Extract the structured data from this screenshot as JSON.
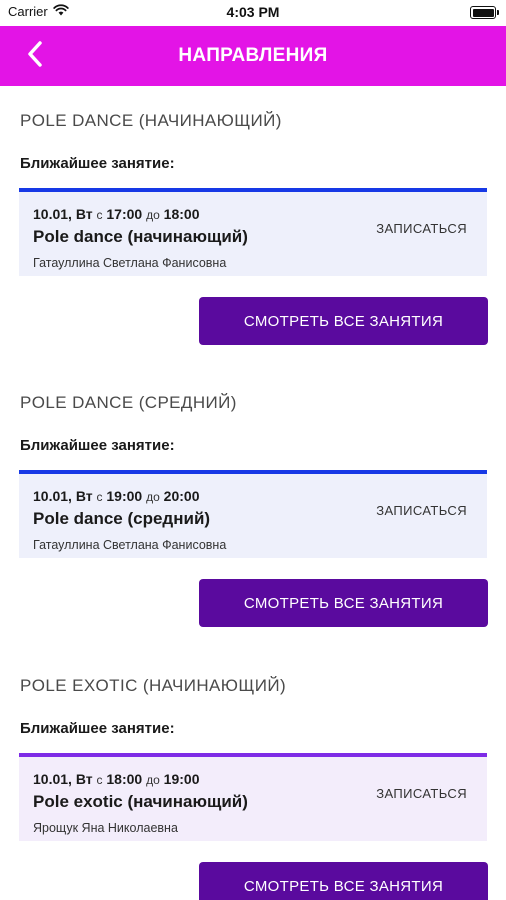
{
  "colors": {
    "nav_background": "#e314e6",
    "button_background": "#5a0a9e",
    "card_border_blue": "#1739e6",
    "card_border_purple": "#7e2be6",
    "card_bg_blue": "#eef0fb",
    "card_bg_purple": "#f3edfb"
  },
  "status_bar": {
    "carrier": "Carrier",
    "time": "4:03 PM"
  },
  "nav": {
    "title": "НАПРАВЛЕНИЯ",
    "back_icon": "chevron-left-icon"
  },
  "sections": [
    {
      "title": "POLE DANCE (НАЧИНАЮЩИЙ)",
      "nearest_label": "Ближайшее занятие:",
      "card": {
        "date_day": "10.01, Вт",
        "from_word": "с",
        "start": "17:00",
        "to_word": "до",
        "end": "18:00",
        "name": "Pole dance (начинающий)",
        "teacher": "Гатауллина Светлана Фанисовна",
        "signup_label": "ЗАПИСАТЬСЯ"
      },
      "all_button": "СМОТРЕТЬ ВСЕ ЗАНЯТИЯ"
    },
    {
      "title": "POLE DANCE (СРЕДНИЙ)",
      "nearest_label": "Ближайшее занятие:",
      "card": {
        "date_day": "10.01, Вт",
        "from_word": "с",
        "start": "19:00",
        "to_word": "до",
        "end": "20:00",
        "name": "Pole dance (средний)",
        "teacher": "Гатауллина Светлана Фанисовна",
        "signup_label": "ЗАПИСАТЬСЯ"
      },
      "all_button": "СМОТРЕТЬ ВСЕ ЗАНЯТИЯ"
    },
    {
      "title": "POLE EXOTIC (НАЧИНАЮЩИЙ)",
      "nearest_label": "Ближайшее занятие:",
      "card": {
        "date_day": "10.01, Вт",
        "from_word": "с",
        "start": "18:00",
        "to_word": "до",
        "end": "19:00",
        "name": "Pole exotic (начинающий)",
        "teacher": "Ярощук Яна Николаевна",
        "signup_label": "ЗАПИСАТЬСЯ"
      },
      "all_button": "СМОТРЕТЬ ВСЕ ЗАНЯТИЯ"
    }
  ]
}
